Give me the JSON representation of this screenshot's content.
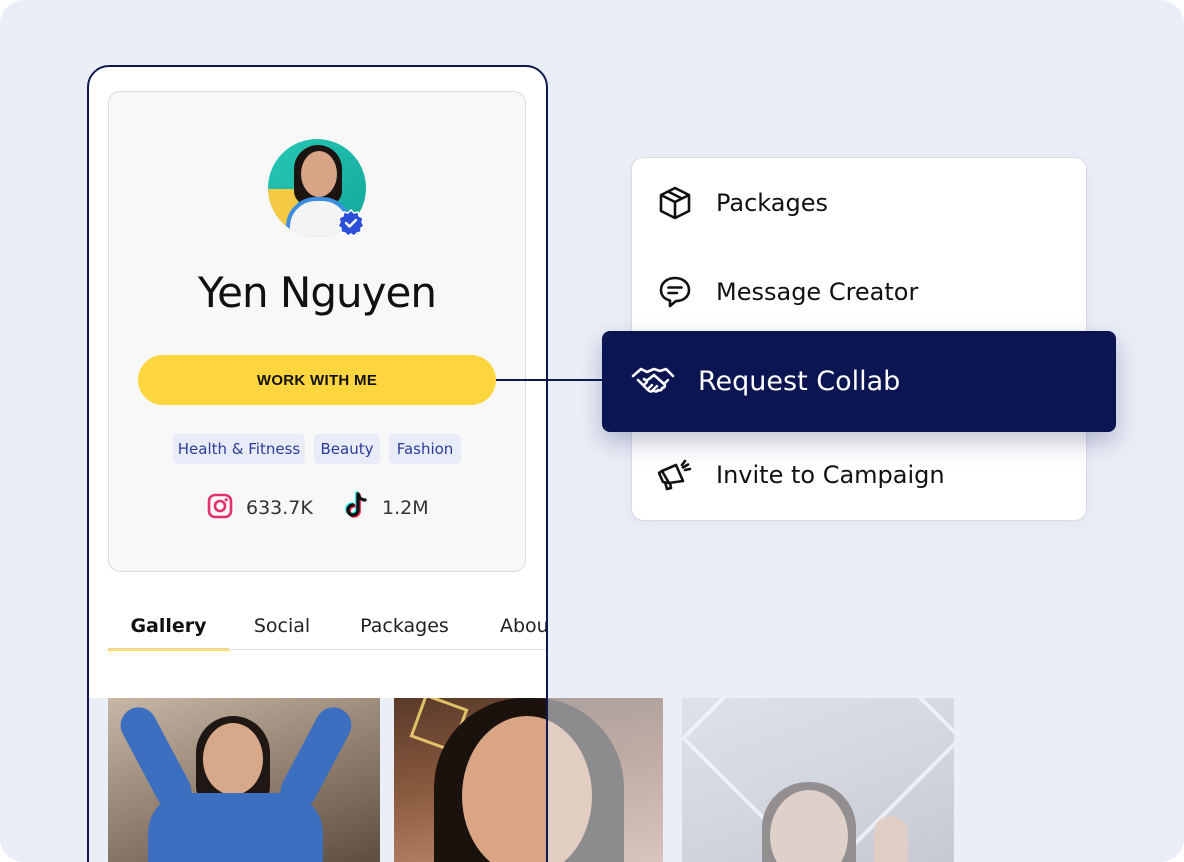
{
  "profile": {
    "name": "Yen Nguyen",
    "cta_label": "WORK WITH ME",
    "tags": [
      "Health & Fitness",
      "Beauty",
      "Fashion"
    ],
    "stats": {
      "instagram": "633.7K",
      "tiktok": "1.2M"
    }
  },
  "tabs": [
    {
      "label": "Gallery",
      "active": true
    },
    {
      "label": "Social",
      "active": false
    },
    {
      "label": "Packages",
      "active": false
    },
    {
      "label": "About",
      "active": false
    }
  ],
  "menu": {
    "items": [
      {
        "label": "Packages",
        "icon": "box-icon"
      },
      {
        "label": "Message Creator",
        "icon": "message-icon"
      },
      {
        "label": "Request Collab",
        "icon": "handshake-icon",
        "highlighted": true
      },
      {
        "label": "Invite to Campaign",
        "icon": "megaphone-icon"
      }
    ]
  },
  "colors": {
    "navy": "#0b1551",
    "cta_yellow": "#fdd53f",
    "tag_bg": "#e8ebf8",
    "tag_text": "#2c3d9b",
    "instagram": "#e1306c",
    "verified": "#2b4fd8"
  }
}
